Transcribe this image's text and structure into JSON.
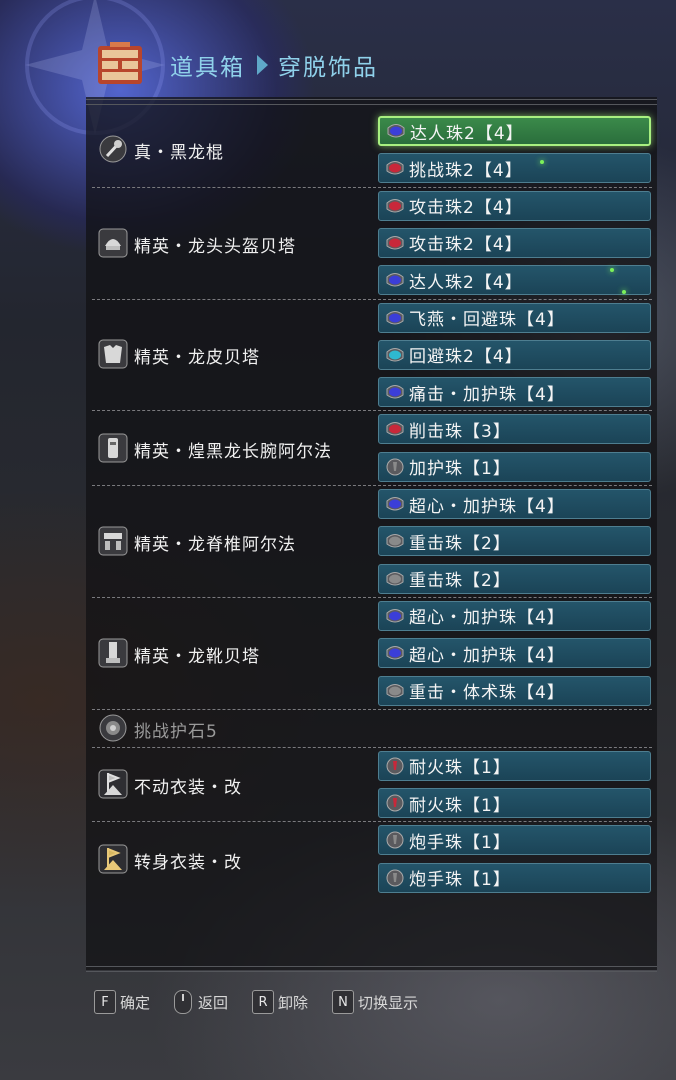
{
  "header": {
    "crumb_root": "道具箱",
    "crumb_current": "穿脱饰品"
  },
  "groups": [
    {
      "name": "真・黑龙棍",
      "icon": "weapon-icon",
      "slots": [
        {
          "label": "达人珠2【4】",
          "jewel": "blue",
          "selected": true
        },
        {
          "label": "挑战珠2【4】",
          "jewel": "red",
          "selected": false
        }
      ]
    },
    {
      "name": "精英・龙头头盔贝塔",
      "icon": "helmet-icon",
      "slots": [
        {
          "label": "攻击珠2【4】",
          "jewel": "red"
        },
        {
          "label": "攻击珠2【4】",
          "jewel": "red"
        },
        {
          "label": "达人珠2【4】",
          "jewel": "blue"
        }
      ]
    },
    {
      "name": "精英・龙皮贝塔",
      "icon": "chest-armor-icon",
      "slots": [
        {
          "label": "飞燕・回避珠【4】",
          "jewel": "blue"
        },
        {
          "label": "回避珠2【4】",
          "jewel": "cyan"
        },
        {
          "label": "痛击・加护珠【4】",
          "jewel": "blue"
        }
      ]
    },
    {
      "name": "精英・煌黑龙长腕阿尔法",
      "icon": "arm-armor-icon",
      "slots": [
        {
          "label": "削击珠【3】",
          "jewel": "red"
        },
        {
          "label": "加护珠【1】",
          "jewel": "small-gray"
        }
      ]
    },
    {
      "name": "精英・龙脊椎阿尔法",
      "icon": "waist-armor-icon",
      "slots": [
        {
          "label": "超心・加护珠【4】",
          "jewel": "blue"
        },
        {
          "label": "重击珠【2】",
          "jewel": "gray"
        },
        {
          "label": "重击珠【2】",
          "jewel": "gray"
        }
      ]
    },
    {
      "name": "精英・龙靴贝塔",
      "icon": "leg-armor-icon",
      "slots": [
        {
          "label": "超心・加护珠【4】",
          "jewel": "blue"
        },
        {
          "label": "超心・加护珠【4】",
          "jewel": "blue"
        },
        {
          "label": "重击・体术珠【4】",
          "jewel": "gray"
        }
      ]
    },
    {
      "name": "挑战护石5",
      "icon": "charm-icon",
      "dim": true,
      "slots": []
    },
    {
      "name": "不动衣装・改",
      "icon": "mantle-icon",
      "slots": [
        {
          "label": "耐火珠【1】",
          "jewel": "small-red"
        },
        {
          "label": "耐火珠【1】",
          "jewel": "small-red"
        }
      ]
    },
    {
      "name": "转身衣装・改",
      "icon": "mantle-gold-icon",
      "slots": [
        {
          "label": "炮手珠【1】",
          "jewel": "small-gray"
        },
        {
          "label": "炮手珠【1】",
          "jewel": "small-gray"
        }
      ]
    }
  ],
  "footer": {
    "confirm_key": "F",
    "confirm_label": "确定",
    "back_label": "返回",
    "remove_key": "R",
    "remove_label": "卸除",
    "toggle_key": "N",
    "toggle_label": "切换显示"
  },
  "colors": {
    "slot_bg": "#1b4457",
    "slot_selected": "#2a6e3c",
    "crumb_text": "#8fd1ea",
    "jewel_blue": "#3b3ed8",
    "jewel_red": "#c8283a",
    "jewel_cyan": "#2fb8d0",
    "jewel_gray": "#8a8a8a"
  }
}
